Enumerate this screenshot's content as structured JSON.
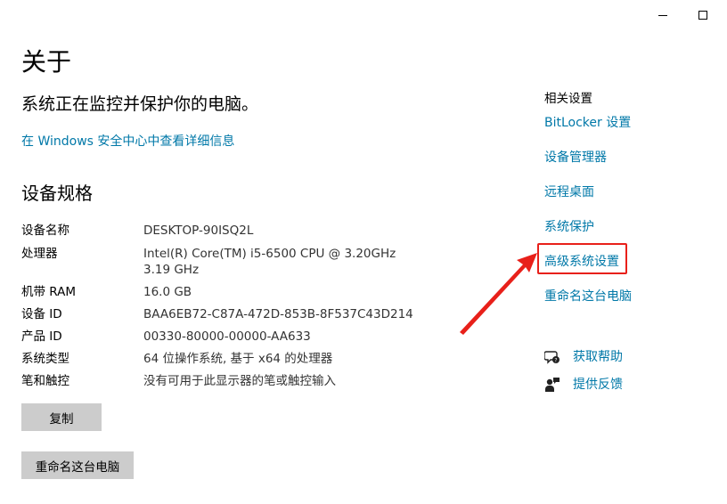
{
  "window": {
    "minimize_icon": "minimize-icon",
    "maximize_icon": "maximize-icon"
  },
  "page": {
    "title": "关于",
    "protection_text": "系统正在监控并保护你的电脑。",
    "security_link": "在 Windows 安全中心中查看详细信息"
  },
  "specs": {
    "title": "设备规格",
    "rows": [
      {
        "label": "设备名称",
        "value": "DESKTOP-90ISQ2L"
      },
      {
        "label": "处理器",
        "value": "Intel(R) Core(TM) i5-6500 CPU @ 3.20GHz   3.19 GHz"
      },
      {
        "label": "机带 RAM",
        "value": "16.0 GB"
      },
      {
        "label": "设备 ID",
        "value": "BAA6EB72-C87A-472D-853B-8F537C43D214"
      },
      {
        "label": "产品 ID",
        "value": "00330-80000-00000-AA633"
      },
      {
        "label": "系统类型",
        "value": "64 位操作系统, 基于 x64 的处理器"
      },
      {
        "label": "笔和触控",
        "value": "没有可用于此显示器的笔或触控输入"
      }
    ],
    "copy_button": "复制",
    "rename_button": "重命名这台电脑"
  },
  "related": {
    "title": "相关设置",
    "links": [
      {
        "label": "BitLocker 设置"
      },
      {
        "label": "设备管理器"
      },
      {
        "label": "远程桌面"
      },
      {
        "label": "系统保护"
      },
      {
        "label": "高级系统设置"
      },
      {
        "label": "重命名这台电脑"
      }
    ]
  },
  "help": {
    "get_help": "获取帮助",
    "feedback": "提供反馈",
    "get_help_icon": "chat-help-icon",
    "feedback_icon": "feedback-person-icon"
  },
  "annotation": {
    "highlight_color": "#e8201a",
    "arrow_color": "#e8201a"
  },
  "colors": {
    "link": "#0078a8",
    "button_bg": "#cccccc"
  }
}
